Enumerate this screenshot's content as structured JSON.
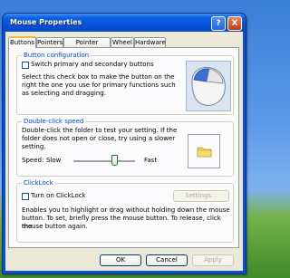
{
  "window": {
    "title": "Mouse Properties"
  },
  "titlebar_buttons": {
    "help": "?",
    "close": "X"
  },
  "tabs": [
    "Buttons",
    "Pointers",
    "Pointer Options",
    "Wheel",
    "Hardware"
  ],
  "button_configuration": {
    "legend": "Button configuration",
    "checkbox_label": "Switch primary and secondary buttons",
    "description_lines": [
      "Select this check box to make the button on the",
      "right the one you use for primary functions such",
      "as selecting and dragging."
    ]
  },
  "double_click": {
    "legend": "Double-click speed",
    "description_lines": [
      "Double-click the folder to test your setting. If the",
      "folder does not open or close, try using a slower",
      "setting."
    ],
    "speed_label": "Speed:",
    "slow_label": "Slow",
    "fast_label": "Fast"
  },
  "clicklock": {
    "legend": "ClickLock",
    "checkbox_label": "Turn on ClickLock",
    "settings_button": "Settings...",
    "description_lines": [
      "Enables you to highlight or drag without holding down the mouse",
      "button. To set, briefly press the mouse button. To release, click the",
      "mouse button again."
    ]
  },
  "footer": {
    "ok": "OK",
    "cancel": "Cancel",
    "apply": "Apply"
  },
  "colors": {
    "title_blue": "#0a5fe0",
    "legend_blue": "#0046d5",
    "active_tab": "#f4bb3e"
  }
}
